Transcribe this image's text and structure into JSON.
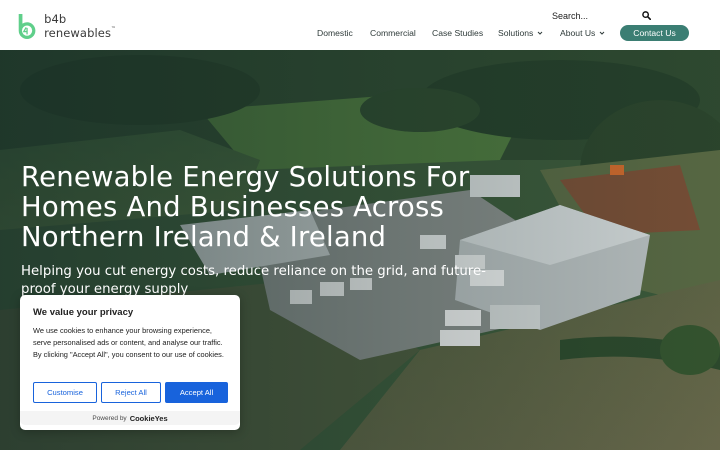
{
  "brand": {
    "name": "b4b renewables",
    "trademark": "™"
  },
  "search": {
    "placeholder": "Search..."
  },
  "nav": {
    "items": [
      {
        "label": "Domestic"
      },
      {
        "label": "Commercial"
      },
      {
        "label": "Case Studies"
      },
      {
        "label": "Solutions"
      },
      {
        "label": "About Us"
      }
    ],
    "contact_label": "Contact Us"
  },
  "hero": {
    "title_lines": [
      "Renewable Energy Solutions For",
      "Homes And Businesses Across",
      "Northern Ireland & Ireland"
    ],
    "subtitle_lines": [
      "Helping you cut energy costs, reduce reliance on the grid, and future-",
      "proof your energy supply"
    ]
  },
  "cookie": {
    "title": "We value your privacy",
    "body": "We use cookies to enhance your browsing experience, serve personalised ads or content, and analyse our traffic. By clicking \"Accept All\", you consent to our use of cookies.",
    "customise_label": "Customise",
    "reject_label": "Reject All",
    "accept_label": "Accept All",
    "powered_by": "Powered by",
    "powered_brand": "CookieYes"
  },
  "colors": {
    "accent": "#3b7e73",
    "logo_green": "#5fcf8a",
    "cookie_blue": "#1863dc"
  },
  "icons": {
    "search": "search-icon",
    "chevron": "chevron-down-icon",
    "logo": "b4b-logo-icon"
  }
}
